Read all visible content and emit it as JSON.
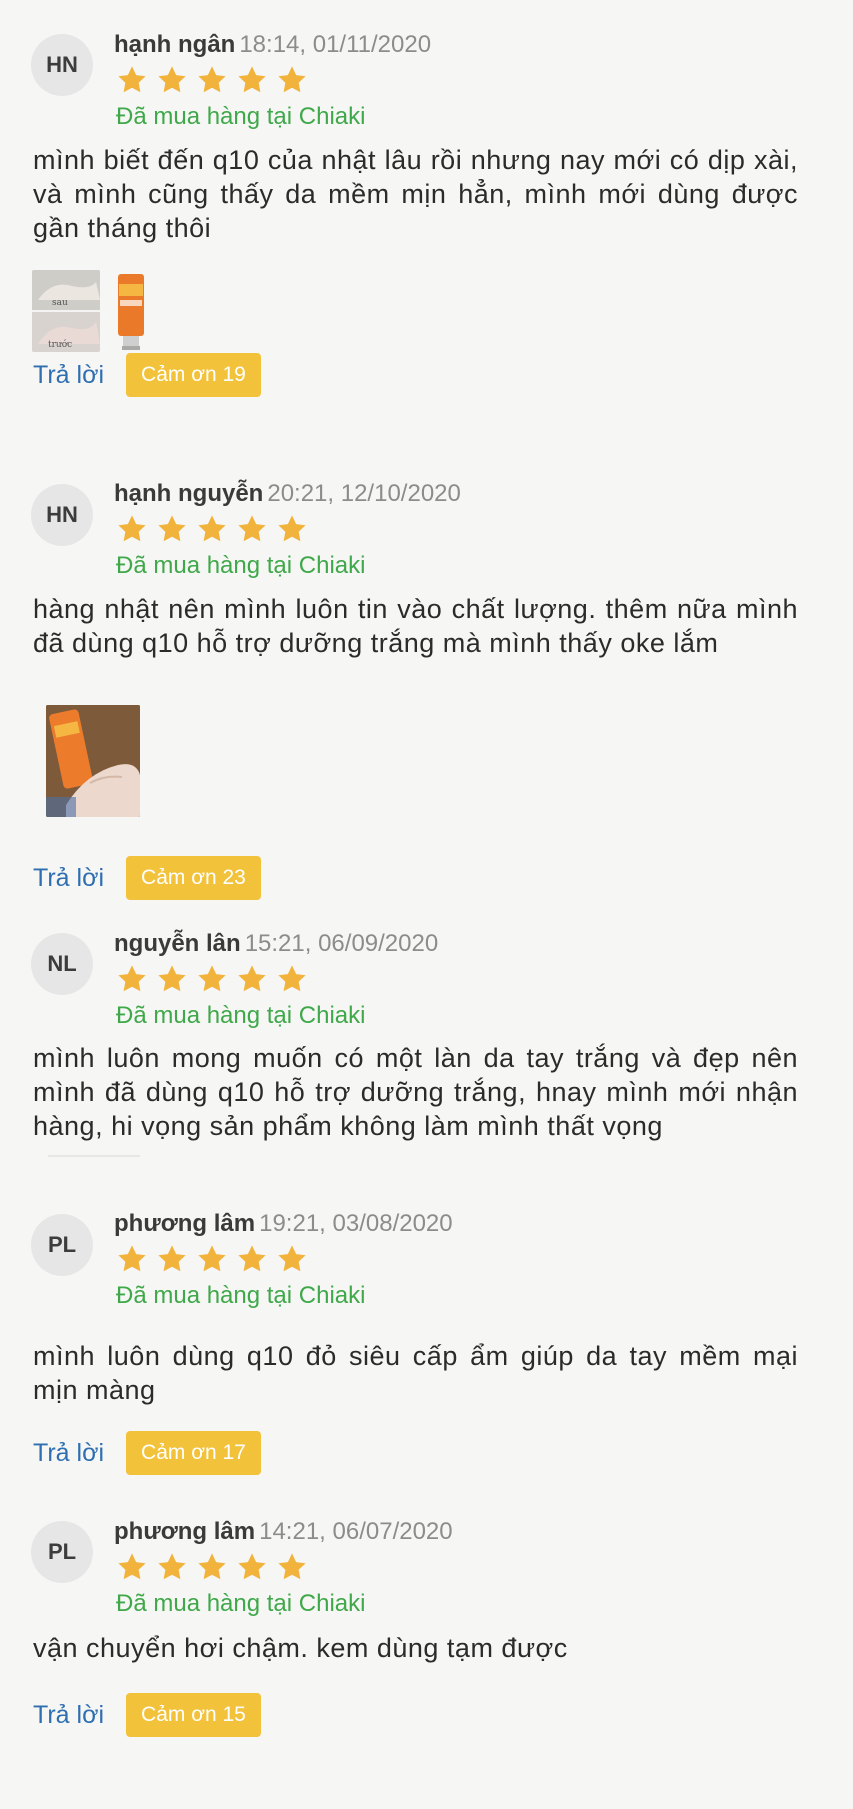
{
  "reviews": [
    {
      "initials": "HN",
      "name": "hạnh ngân",
      "time": "18:14, 01/11/2020",
      "rating": 5,
      "bought": "Đã mua hàng tại Chiaki",
      "content": "mình biết đến q10 của nhật lâu rồi nhưng nay mới có dịp xài, và mình cũng thấy da mềm mịn hẳn, mình mới dùng được gần tháng thôi",
      "images": [
        "hand-before-after-photo",
        "product-tube-photo"
      ],
      "photo_labels": [
        "sau",
        "trước"
      ],
      "reply_label": "Trả lời",
      "thanks_label": "Cảm ơn 19"
    },
    {
      "initials": "HN",
      "name": "hạnh nguyễn",
      "time": "20:21, 12/10/2020",
      "rating": 5,
      "bought": "Đã mua hàng tại Chiaki",
      "content": "hàng nhật nên mình luôn tin vào chất lượng. thêm nữa mình đã dùng q10 hỗ trợ dưỡng trắng mà mình thấy oke lắm",
      "images": [
        "hand-with-product-photo"
      ],
      "reply_label": "Trả lời",
      "thanks_label": "Cảm ơn 23"
    },
    {
      "initials": "NL",
      "name": "nguyễn lân",
      "time": "15:21, 06/09/2020",
      "rating": 5,
      "bought": "Đã mua hàng tại Chiaki",
      "content": "mình luôn mong muốn có một làn da tay trắng và đẹp nên mình đã dùng q10 hỗ trợ dưỡng trắng, hnay mình mới nhận hàng, hi vọng sản phẩm không làm mình thất vọng",
      "images": []
    },
    {
      "initials": "PL",
      "name": "phương lâm",
      "time": "19:21, 03/08/2020",
      "rating": 5,
      "bought": "Đã mua hàng tại Chiaki",
      "content": "mình luôn dùng q10 đỏ siêu cấp ẩm giúp da tay mềm mại mịn màng",
      "images": [],
      "reply_label": "Trả lời",
      "thanks_label": "Cảm ơn 17"
    },
    {
      "initials": "PL",
      "name": "phương lâm",
      "time": "14:21, 06/07/2020",
      "rating": 5,
      "bought": "Đã mua hàng tại Chiaki",
      "content": "vận chuyển hơi chậm. kem dùng tạm được",
      "images": [],
      "reply_label": "Trả lời",
      "thanks_label": "Cảm ơn 15"
    }
  ],
  "colors": {
    "star": "#f2b33d",
    "bought": "#3fa84a",
    "reply": "#2f6fb1",
    "thanks_bg": "#f2c23a"
  },
  "icons": {
    "star": "star-icon"
  }
}
